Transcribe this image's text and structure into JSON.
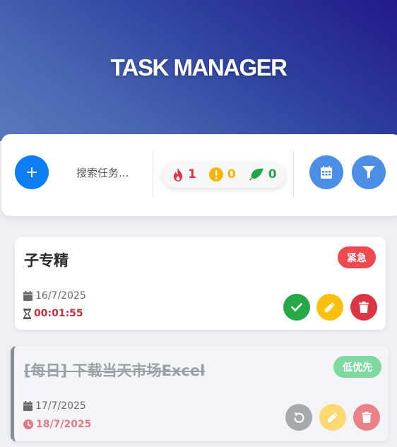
{
  "app": {
    "title": "TASK MANAGER"
  },
  "toolbar": {
    "add_icon": "plus-icon",
    "search_placeholder": "搜索任务...",
    "stats": {
      "urgent": "1",
      "medium": "0",
      "low": "0"
    },
    "calendar_icon": "calendar-icon",
    "filter_icon": "filter-icon"
  },
  "tasks": [
    {
      "title": "子专精",
      "badge": "紧急",
      "date": "16/7/2025",
      "timer": "00:01:55",
      "completed": false
    },
    {
      "title": "[每日] 下载当天市场Excel",
      "badge": "低优先",
      "date": "17/7/2025",
      "due": "18/7/2025",
      "completed": true
    }
  ],
  "colors": {
    "primary": "#0d7df5",
    "urgent": "#dc3545",
    "medium": "#f5b400",
    "low": "#22a447",
    "accent": "#4b8fe4"
  }
}
